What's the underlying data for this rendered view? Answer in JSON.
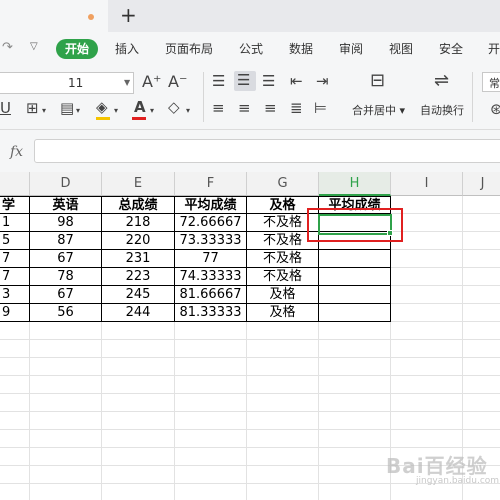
{
  "tabbar": {
    "new_tab": "+"
  },
  "menu": {
    "items": [
      "开始",
      "插入",
      "页面布局",
      "公式",
      "数据",
      "审阅",
      "视图",
      "安全",
      "开"
    ]
  },
  "toolbar": {
    "font_size": "11",
    "grow_font": "A⁺",
    "shrink_font": "A⁻",
    "merge_label": "合并居中",
    "wrap_label": "自动换行",
    "right_cut": "常"
  },
  "formula_bar": {
    "fx": "fx",
    "value": ""
  },
  "columns": [
    "D",
    "E",
    "F",
    "G",
    "H",
    "I",
    "J"
  ],
  "selected_column": "H",
  "table": {
    "headers": [
      "学",
      "英语",
      "总成绩",
      "平均成绩",
      "及格",
      "平均成绩"
    ],
    "rows": [
      [
        "1",
        "98",
        "218",
        "72.66667",
        "不及格",
        ""
      ],
      [
        "5",
        "87",
        "220",
        "73.33333",
        "不及格",
        ""
      ],
      [
        "7",
        "67",
        "231",
        "77",
        "不及格",
        ""
      ],
      [
        "7",
        "78",
        "223",
        "74.33333",
        "不及格",
        ""
      ],
      [
        "3",
        "67",
        "245",
        "81.66667",
        "及格",
        ""
      ],
      [
        "9",
        "56",
        "244",
        "81.33333",
        "及格",
        ""
      ]
    ]
  },
  "watermark": {
    "brand": "Bai百经验",
    "url": "jingyan.baidu.com"
  },
  "colors": {
    "accent": "#2fa24a",
    "annotation": "#e02020"
  }
}
